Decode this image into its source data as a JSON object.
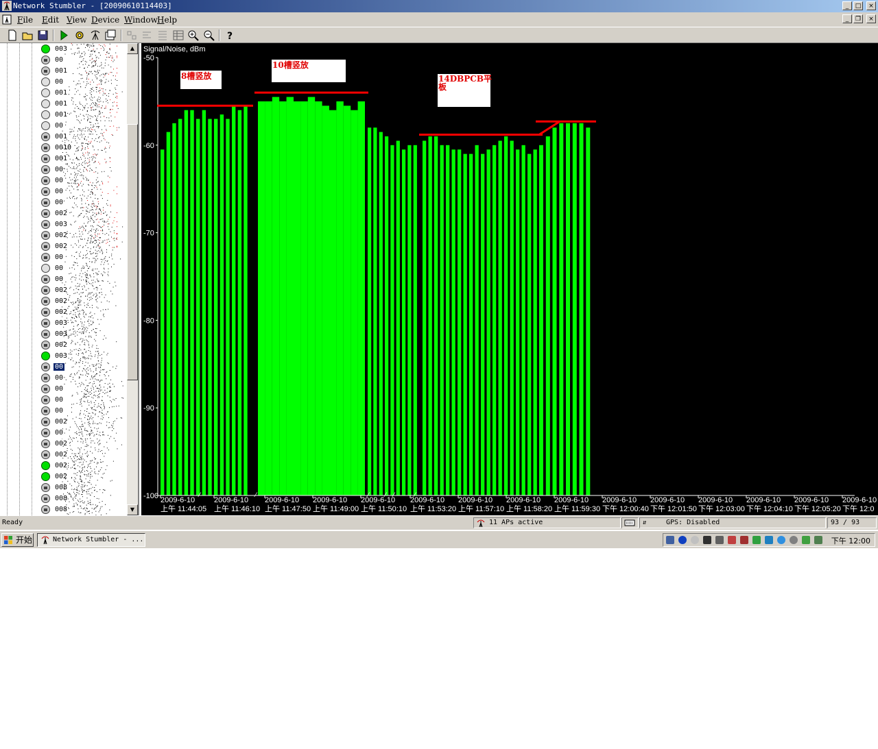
{
  "window": {
    "title": "Network Stumbler - [20090610114403]",
    "controls": [
      "_",
      "□",
      "×"
    ]
  },
  "menubar": {
    "items": [
      "File",
      "Edit",
      "View",
      "Device",
      "Window",
      "Help"
    ],
    "mnemonics": [
      "F",
      "E",
      "V",
      "D",
      "W",
      "H"
    ]
  },
  "toolbar": {
    "buttons": [
      "new-icon",
      "open-icon",
      "save-icon",
      "play-icon",
      "gear-icon",
      "auto-config-icon",
      "properties-icon",
      "large-icons-icon",
      "small-icons-icon",
      "list-icon",
      "details-icon",
      "zoom-in-icon",
      "zoom-out-icon",
      "help-icon"
    ]
  },
  "tree": {
    "items": [
      {
        "label": "003",
        "icon": "green"
      },
      {
        "label": "00",
        "icon": "lock"
      },
      {
        "label": "001",
        "icon": "lock"
      },
      {
        "label": "00",
        "icon": "grey"
      },
      {
        "label": "001",
        "icon": "grey"
      },
      {
        "label": "001",
        "icon": "grey"
      },
      {
        "label": "001",
        "icon": "grey"
      },
      {
        "label": "00",
        "icon": "grey"
      },
      {
        "label": "001",
        "icon": "lock"
      },
      {
        "label": "0010",
        "icon": "lock"
      },
      {
        "label": "001",
        "icon": "lock"
      },
      {
        "label": "00",
        "icon": "lock"
      },
      {
        "label": "00",
        "icon": "lock"
      },
      {
        "label": "00",
        "icon": "lock"
      },
      {
        "label": "00",
        "icon": "lock"
      },
      {
        "label": "002",
        "icon": "lock"
      },
      {
        "label": "003",
        "icon": "lock"
      },
      {
        "label": "002",
        "icon": "lock"
      },
      {
        "label": "002",
        "icon": "lock"
      },
      {
        "label": "00",
        "icon": "lock"
      },
      {
        "label": "00",
        "icon": "grey"
      },
      {
        "label": "00",
        "icon": "lock"
      },
      {
        "label": "002",
        "icon": "lock"
      },
      {
        "label": "002",
        "icon": "lock"
      },
      {
        "label": "002",
        "icon": "lock"
      },
      {
        "label": "003",
        "icon": "lock"
      },
      {
        "label": "003",
        "icon": "lock"
      },
      {
        "label": "002",
        "icon": "lock"
      },
      {
        "label": "003",
        "icon": "green"
      },
      {
        "label": "00",
        "icon": "lock",
        "selected": true
      },
      {
        "label": "00",
        "icon": "lock"
      },
      {
        "label": "00",
        "icon": "lock"
      },
      {
        "label": "00",
        "icon": "lock"
      },
      {
        "label": "00",
        "icon": "lock"
      },
      {
        "label": "002",
        "icon": "lock"
      },
      {
        "label": "00",
        "icon": "lock"
      },
      {
        "label": "002",
        "icon": "lock"
      },
      {
        "label": "002",
        "icon": "lock"
      },
      {
        "label": "002",
        "icon": "green"
      },
      {
        "label": "002",
        "icon": "green"
      },
      {
        "label": "008",
        "icon": "lock"
      },
      {
        "label": "008",
        "icon": "lock"
      },
      {
        "label": "008",
        "icon": "lock"
      }
    ]
  },
  "chart_data": {
    "type": "bar",
    "title": "Signal/Noise, dBm",
    "ylim": [
      -100,
      -50
    ],
    "yticks": [
      -50,
      -60,
      -70,
      -80,
      -90,
      -100
    ],
    "ytick_labels": [
      "-50",
      "-60",
      "-70",
      "-80",
      "-90",
      "-100"
    ],
    "bar_color": "#00ff00",
    "background": "#000000",
    "annotation_line_color": "#ff0000",
    "xtick_labels": [
      {
        "date": "2009-6-10",
        "time": "上午 11:44:05"
      },
      {
        "date": "2009-6-10",
        "time": "上午 11:46:10"
      },
      {
        "date": "2009-6-10",
        "time": "上午 11:47:50"
      },
      {
        "date": "2009-6-10",
        "time": "上午 11:49:00"
      },
      {
        "date": "2009-6-10",
        "time": "上午 11:50:10"
      },
      {
        "date": "2009-6-10",
        "time": "上午 11:53:20"
      },
      {
        "date": "2009-6-10",
        "time": "上午 11:57:10"
      },
      {
        "date": "2009-6-10",
        "time": "上午 11:58:20"
      },
      {
        "date": "2009-6-10",
        "time": "上午 11:59:30"
      },
      {
        "date": "2009-6-10",
        "time": "下午 12:00:40"
      },
      {
        "date": "2009-6-10",
        "time": "下午 12:01:50"
      },
      {
        "date": "2009-6-10",
        "time": "下午 12:03:00"
      },
      {
        "date": "2009-6-10",
        "time": "下午 12:04:10"
      },
      {
        "date": "2009-6-10",
        "time": "下午 12:05:20"
      },
      {
        "date": "2009-6-10",
        "time": "下午 12:0"
      }
    ],
    "segments": [
      {
        "label": "8槽竖放",
        "level": -55.5,
        "bar_top": [
          -60.5,
          -58.5,
          -57.5,
          -57,
          -56,
          -56,
          -57,
          -56,
          -57,
          -57,
          -56.5,
          -57,
          -55.5,
          -56,
          -55.5
        ]
      },
      {
        "label": "10槽竖放",
        "level": -54,
        "bar_top": [
          -55,
          -55,
          -54.5,
          -55,
          -54.5,
          -55,
          -55,
          -54.5,
          -55,
          -55.5,
          -56,
          -55,
          -55.5,
          -56,
          -55
        ]
      },
      {
        "label": "",
        "level": null,
        "bar_top": [
          -58,
          -58,
          -58.5,
          -59,
          -60,
          -59.5,
          -60.5,
          -60,
          -60
        ]
      },
      {
        "label": "14DBPCB平板",
        "level": -58.8,
        "bar_top": [
          -59.5,
          -59,
          -59,
          -60,
          -60,
          -60.5,
          -60.5,
          -61,
          -61,
          -60,
          -61,
          -60.5,
          -60,
          -59.5,
          -59,
          -59.5,
          -60.5,
          -60,
          -61,
          -60.5
        ]
      },
      {
        "label": "",
        "level": -57.3,
        "bar_top": [
          -60,
          -59,
          -58,
          -57.5,
          -57.5,
          -57.5,
          -57.5,
          -58
        ]
      }
    ]
  },
  "statusbar": {
    "ready": "Ready",
    "aps": "11 APs active",
    "gps": "GPS: Disabled",
    "count": "93 / 93"
  },
  "taskbar": {
    "start": "开始",
    "item": "Network Stumbler - ...",
    "clock": "下午 12:00"
  }
}
